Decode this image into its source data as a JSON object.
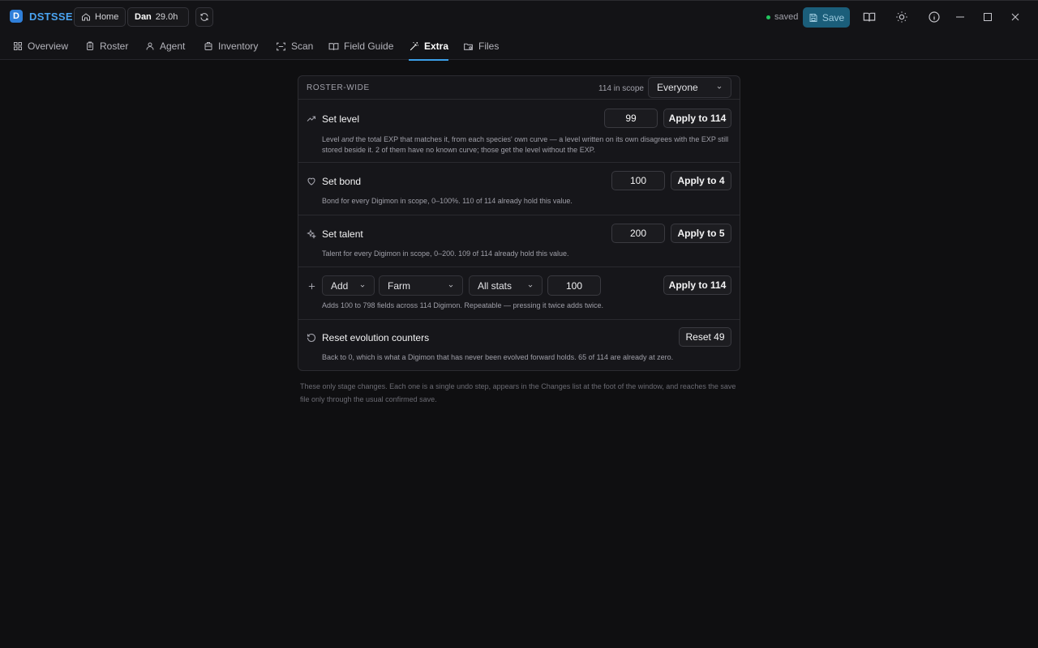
{
  "app": {
    "logo_letter": "D",
    "name": "DSTSSE"
  },
  "titlebar": {
    "home_label": "Home",
    "profile_name": "Dan",
    "profile_time": "29.0h",
    "status_text": "saved",
    "save_label": "Save"
  },
  "tabs": [
    {
      "label": "Overview",
      "icon": "grid-icon"
    },
    {
      "label": "Roster",
      "icon": "clipboard-icon"
    },
    {
      "label": "Agent",
      "icon": "user-icon"
    },
    {
      "label": "Inventory",
      "icon": "package-icon"
    },
    {
      "label": "Scan",
      "icon": "scan-icon"
    },
    {
      "label": "Field Guide",
      "icon": "book-icon"
    },
    {
      "label": "Extra",
      "icon": "wand-icon",
      "active": true
    },
    {
      "label": "Files",
      "icon": "folder-icon"
    }
  ],
  "panel": {
    "title": "ROSTER-WIDE",
    "scope_count": "114 in scope",
    "scope_select": "Everyone",
    "rows": {
      "level": {
        "title": "Set level",
        "value": "99",
        "button": "Apply to 114",
        "desc_pre": "Level ",
        "desc_em": "and",
        "desc_post": " the total EXP that matches it, from each species' own curve — a level written on its own disagrees with the EXP still stored beside it. 2 of them have no known curve; those get the level without the EXP."
      },
      "bond": {
        "title": "Set bond",
        "value": "100",
        "button": "Apply to 4",
        "desc": "Bond for every Digimon in scope, 0–100%. 110 of 114 already hold this value."
      },
      "talent": {
        "title": "Set talent",
        "value": "200",
        "button": "Apply to 5",
        "desc": "Talent for every Digimon in scope, 0–200. 109 of 114 already hold this value."
      },
      "add": {
        "mode": "Add",
        "field": "Farm",
        "stats": "All stats",
        "value": "100",
        "button": "Apply to 114",
        "desc": "Adds 100 to 798 fields across 114 Digimon. Repeatable — pressing it twice adds twice."
      },
      "reset": {
        "title": "Reset evolution counters",
        "button": "Reset 49",
        "desc": "Back to 0, which is what a Digimon that has never been evolved forward holds. 65 of 114 are already at zero."
      }
    }
  },
  "footer_note": "These only stage changes. Each one is a single undo step, appears in the Changes list at the foot of the window, and reaches the save file only through the usual confirmed save.",
  "colors": {
    "accent": "#3b9fe8",
    "save_bg": "#1b5e7a",
    "status_dot": "#22c55e",
    "background": "#0f0f11"
  }
}
